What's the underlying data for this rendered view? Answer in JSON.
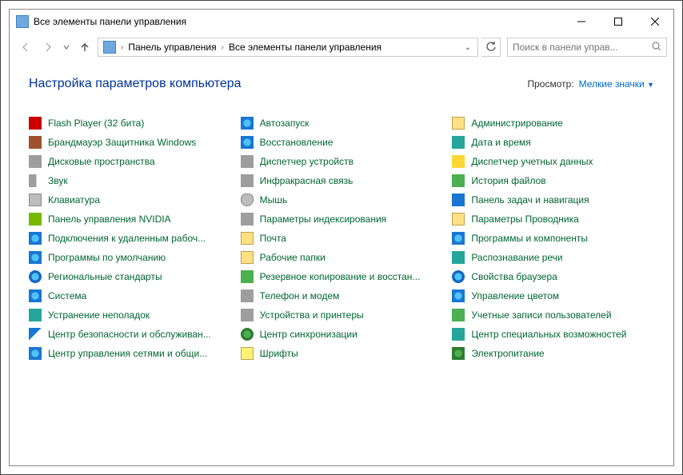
{
  "window": {
    "title": "Все элементы панели управления"
  },
  "breadcrumb": {
    "root": "Панель управления",
    "current": "Все элементы панели управления"
  },
  "search": {
    "placeholder": "Поиск в панели управ..."
  },
  "header": {
    "title": "Настройка параметров компьютера",
    "view_label": "Просмотр:",
    "view_value": "Мелкие значки"
  },
  "items": [
    {
      "label": "Flash Player (32 бита)",
      "icon": "ic-red",
      "name": "flash-player"
    },
    {
      "label": "Автозапуск",
      "icon": "ic-cp",
      "name": "autoplay"
    },
    {
      "label": "Администрирование",
      "icon": "ic-folder",
      "name": "admin-tools"
    },
    {
      "label": "Брандмауэр Защитника Windows",
      "icon": "ic-brown",
      "name": "firewall"
    },
    {
      "label": "Восстановление",
      "icon": "ic-cp",
      "name": "recovery"
    },
    {
      "label": "Дата и время",
      "icon": "ic-teal",
      "name": "date-time"
    },
    {
      "label": "Дисковые пространства",
      "icon": "ic-gray",
      "name": "storage-spaces"
    },
    {
      "label": "Диспетчер устройств",
      "icon": "ic-gray",
      "name": "device-manager"
    },
    {
      "label": "Диспетчер учетных данных",
      "icon": "ic-yellow",
      "name": "credential-manager"
    },
    {
      "label": "Звук",
      "icon": "ic-sound",
      "name": "sound"
    },
    {
      "label": "Инфракрасная связь",
      "icon": "ic-gray",
      "name": "infrared"
    },
    {
      "label": "История файлов",
      "icon": "ic-green",
      "name": "file-history"
    },
    {
      "label": "Клавиатура",
      "icon": "ic-kb",
      "name": "keyboard"
    },
    {
      "label": "Мышь",
      "icon": "ic-mouse",
      "name": "mouse"
    },
    {
      "label": "Панель задач и навигация",
      "icon": "ic-blue",
      "name": "taskbar"
    },
    {
      "label": "Панель управления NVIDIA",
      "icon": "ic-nvidia",
      "name": "nvidia"
    },
    {
      "label": "Параметры индексирования",
      "icon": "ic-gray",
      "name": "indexing"
    },
    {
      "label": "Параметры Проводника",
      "icon": "ic-folder",
      "name": "explorer-options"
    },
    {
      "label": "Подключения к удаленным рабоч...",
      "icon": "ic-cp",
      "name": "remote-app"
    },
    {
      "label": "Почта",
      "icon": "ic-mail",
      "name": "mail"
    },
    {
      "label": "Программы и компоненты",
      "icon": "ic-cp",
      "name": "programs"
    },
    {
      "label": "Программы по умолчанию",
      "icon": "ic-cp",
      "name": "default-programs"
    },
    {
      "label": "Рабочие папки",
      "icon": "ic-folder",
      "name": "work-folders"
    },
    {
      "label": "Распознавание речи",
      "icon": "ic-teal",
      "name": "speech"
    },
    {
      "label": "Региональные стандарты",
      "icon": "ic-globe",
      "name": "region"
    },
    {
      "label": "Резервное копирование и восстан...",
      "icon": "ic-green",
      "name": "backup"
    },
    {
      "label": "Свойства браузера",
      "icon": "ic-globe",
      "name": "internet-options"
    },
    {
      "label": "Система",
      "icon": "ic-cp",
      "name": "system"
    },
    {
      "label": "Телефон и модем",
      "icon": "ic-gray",
      "name": "phone-modem"
    },
    {
      "label": "Управление цветом",
      "icon": "ic-cp",
      "name": "color-management"
    },
    {
      "label": "Устранение неполадок",
      "icon": "ic-teal",
      "name": "troubleshooting"
    },
    {
      "label": "Устройства и принтеры",
      "icon": "ic-gray",
      "name": "devices-printers"
    },
    {
      "label": "Учетные записи пользователей",
      "icon": "ic-green",
      "name": "user-accounts"
    },
    {
      "label": "Центр безопасности и обслуживан...",
      "icon": "ic-flag",
      "name": "security-center"
    },
    {
      "label": "Центр синхронизации",
      "icon": "ic-sync",
      "name": "sync-center"
    },
    {
      "label": "Центр специальных возможностей",
      "icon": "ic-teal",
      "name": "ease-of-access"
    },
    {
      "label": "Центр управления сетями и общи...",
      "icon": "ic-cp",
      "name": "network-center"
    },
    {
      "label": "Шрифты",
      "icon": "ic-font",
      "name": "fonts"
    },
    {
      "label": "Электропитание",
      "icon": "ic-power",
      "name": "power-options"
    }
  ]
}
